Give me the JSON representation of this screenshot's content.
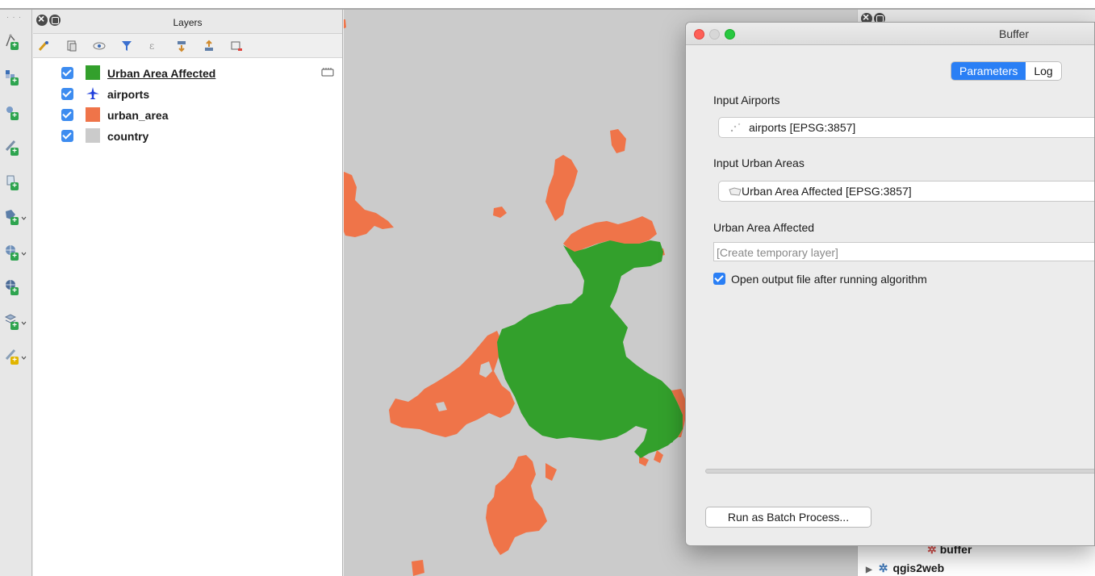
{
  "layers_panel": {
    "title": "Layers",
    "layers": [
      {
        "name": "Urban Area Affected",
        "checked": true,
        "color": "#33a02c",
        "symbol": "fill",
        "active": true
      },
      {
        "name": "airports",
        "checked": true,
        "color": "#1f3fdc",
        "symbol": "plane-icon"
      },
      {
        "name": "urban_area",
        "checked": true,
        "color": "#ef7449",
        "symbol": "fill"
      },
      {
        "name": "country",
        "checked": true,
        "color": "#cbcbcb",
        "symbol": "fill"
      }
    ]
  },
  "map": {
    "background_color": "#cbcbcb",
    "urban_color": "#ef7449",
    "affected_color": "#33a02c"
  },
  "toolbox": {
    "items": [
      "buffer",
      "qgis2web"
    ]
  },
  "dialog": {
    "title": "Buffer",
    "tabs": {
      "parameters": "Parameters",
      "log": "Log"
    },
    "input_airports_label": "Input Airports",
    "input_airports_value": "airports [EPSG:3857]",
    "input_urban_label": "Input Urban Areas",
    "input_urban_value": "Urban Area Affected [EPSG:3857]",
    "output_label": "Urban Area Affected",
    "output_placeholder": "[Create temporary layer]",
    "open_output_label": "Open output file after running algorithm",
    "open_output_checked": true,
    "batch_button": "Run as Batch Process..."
  }
}
